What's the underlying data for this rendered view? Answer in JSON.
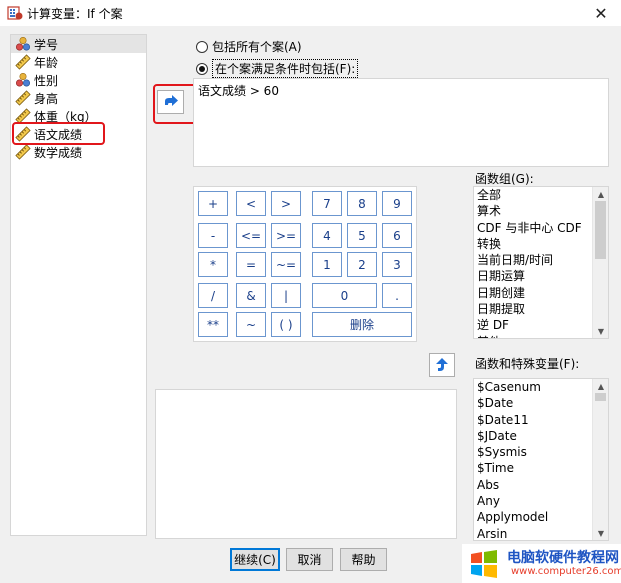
{
  "window": {
    "title": "计算变量：If 个案",
    "close_glyph": "✕"
  },
  "variables": [
    {
      "label": "学号",
      "icon": "nominal-variable-icon",
      "selected": true
    },
    {
      "label": "年龄",
      "icon": "scale-ruler-icon"
    },
    {
      "label": "性别",
      "icon": "nominal-variable-icon"
    },
    {
      "label": "身高",
      "icon": "scale-ruler-icon"
    },
    {
      "label": "体重（kg）",
      "icon": "scale-ruler-icon"
    },
    {
      "label": "语文成绩",
      "icon": "scale-ruler-icon"
    },
    {
      "label": "数学成绩",
      "icon": "scale-ruler-icon"
    }
  ],
  "options": {
    "include_all": "包括所有个案(A)",
    "include_if": "在个案满足条件时包括(F):"
  },
  "expression": "语文成绩 > 60",
  "keypad": {
    "row1": [
      "+",
      "<",
      ">",
      "7",
      "8",
      "9"
    ],
    "row2": [
      "-",
      "<=",
      ">=",
      "4",
      "5",
      "6"
    ],
    "row3": [
      "*",
      "=",
      "~=",
      "1",
      "2",
      "3"
    ],
    "row4": [
      "/",
      "&",
      "|",
      "0",
      "."
    ],
    "row5": [
      "**",
      "~",
      "( )",
      "删除"
    ]
  },
  "function_groups": {
    "label": "函数组(G):",
    "items": [
      "全部",
      "算术",
      "CDF 与非中心 CDF",
      "转换",
      "当前日期/时间",
      "日期运算",
      "日期创建",
      "日期提取",
      "逆 DF",
      "其他"
    ]
  },
  "functions": {
    "label": "函数和特殊变量(F):",
    "items": [
      "$Casenum",
      "$Date",
      "$Date11",
      "$JDate",
      "$Sysmis",
      "$Time",
      "Abs",
      "Any",
      "Applymodel",
      "Arsin"
    ]
  },
  "buttons": {
    "continue": "继续(C)",
    "cancel": "取消",
    "help": "帮助"
  },
  "watermark": {
    "text": "电脑软硬件教程网",
    "url": "www.computer26.com"
  },
  "colors": {
    "highlight_red": "#e1161b",
    "key_blue": "#6b96cf",
    "arrow_blue": "#1f6fd6"
  }
}
